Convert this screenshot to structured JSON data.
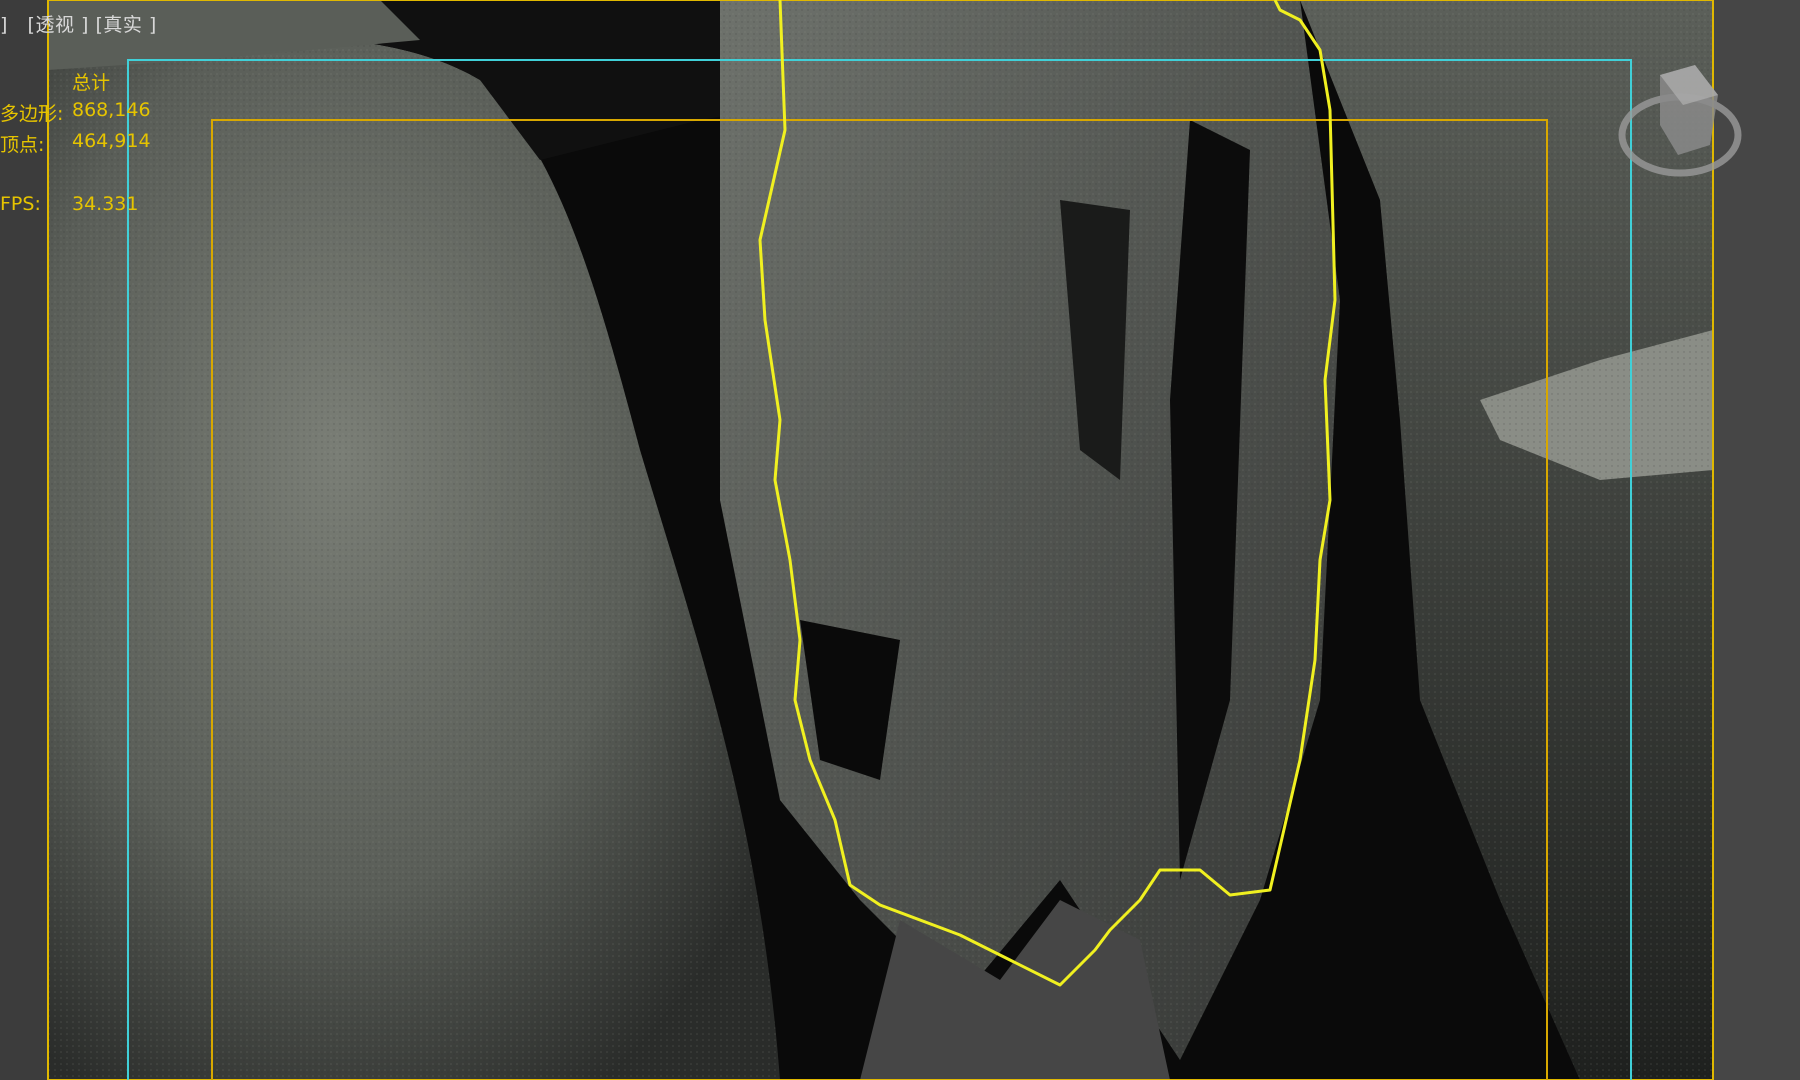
{
  "viewport": {
    "labels": [
      "[",
      "透视",
      "]",
      "[",
      "真实",
      "]"
    ],
    "label_left_bracket": "]",
    "view_label": "[透视 ]",
    "shading_label": "[真实 ]"
  },
  "stats": {
    "header": "总计",
    "polygons_label": "多边形:",
    "polygons_value": "868,146",
    "vertices_label": "顶点:",
    "vertices_value": "464,914",
    "fps_label": "FPS:",
    "fps_value": "34.331"
  },
  "colors": {
    "viewport_bg": "#464646",
    "stats_text": "#e6c400",
    "safe_frame_outer": "#e0b800",
    "safe_frame_inner": "#d8a800",
    "safe_frame_cyan": "#40d0d8",
    "selection_outline": "#f0f020"
  },
  "icons": {
    "viewcube": "viewcube-icon"
  }
}
